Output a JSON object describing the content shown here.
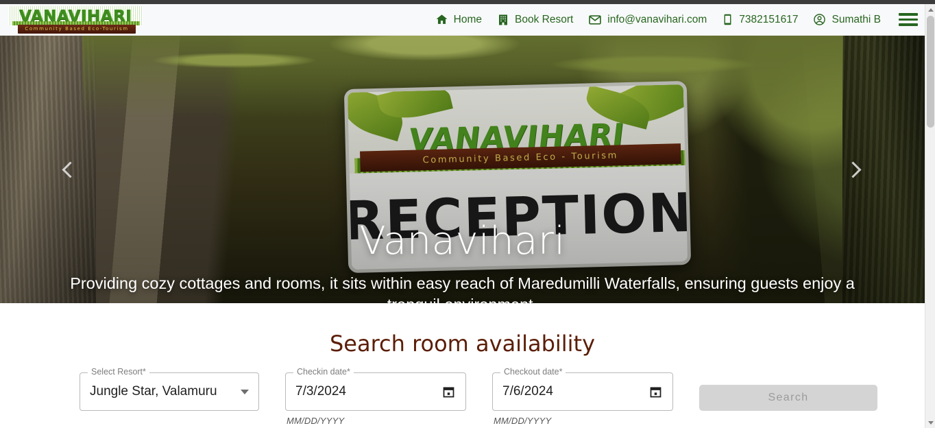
{
  "window": {
    "scrollbar": {
      "up_arrow": "▲",
      "down_arrow": "▼"
    }
  },
  "navbar": {
    "logo": {
      "wordmark": "VANAVIHARI",
      "tagline": "Community Based Eco-Tourism"
    },
    "items": [
      {
        "icon": "home-icon",
        "label": "Home"
      },
      {
        "icon": "hotel-icon",
        "label": "Book Resort"
      },
      {
        "icon": "email-icon",
        "label": "info@vanavihari.com"
      },
      {
        "icon": "phone-icon",
        "label": "7382151617"
      },
      {
        "icon": "account-icon",
        "label": "Sumathi B"
      }
    ],
    "menu_button": "hamburger-menu"
  },
  "hero": {
    "title": "Vanavihari",
    "subtitle": "Providing cozy cottages and rooms, it sits within easy reach of Maredumilli Waterfalls, ensuring guests enjoy a tranquil environment.",
    "prev_label": "Previous slide",
    "next_label": "Next slide",
    "sign": {
      "wordmark": "VANAVIHARI",
      "tagline": "Community Based Eco - Tourism",
      "headline": "RECEPTION"
    }
  },
  "search": {
    "heading": "Search room availability",
    "resort": {
      "label": "Select Resort*",
      "value": "Jungle Star, Valamuru"
    },
    "checkin": {
      "label": "Checkin date*",
      "value": "7/3/2024",
      "helper": "MM/DD/YYYY"
    },
    "checkout": {
      "label": "Checkout date*",
      "value": "7/6/2024",
      "helper": "MM/DD/YYYY"
    },
    "submit_label": "Search"
  },
  "colors": {
    "nav_green": "#276620",
    "heading_brown": "#5b1d06",
    "disabled_button_bg": "#d4d4d4",
    "disabled_button_text": "#9b9b9b",
    "page_bg": "#ffffff",
    "navbar_bg": "#f8f9fa"
  }
}
